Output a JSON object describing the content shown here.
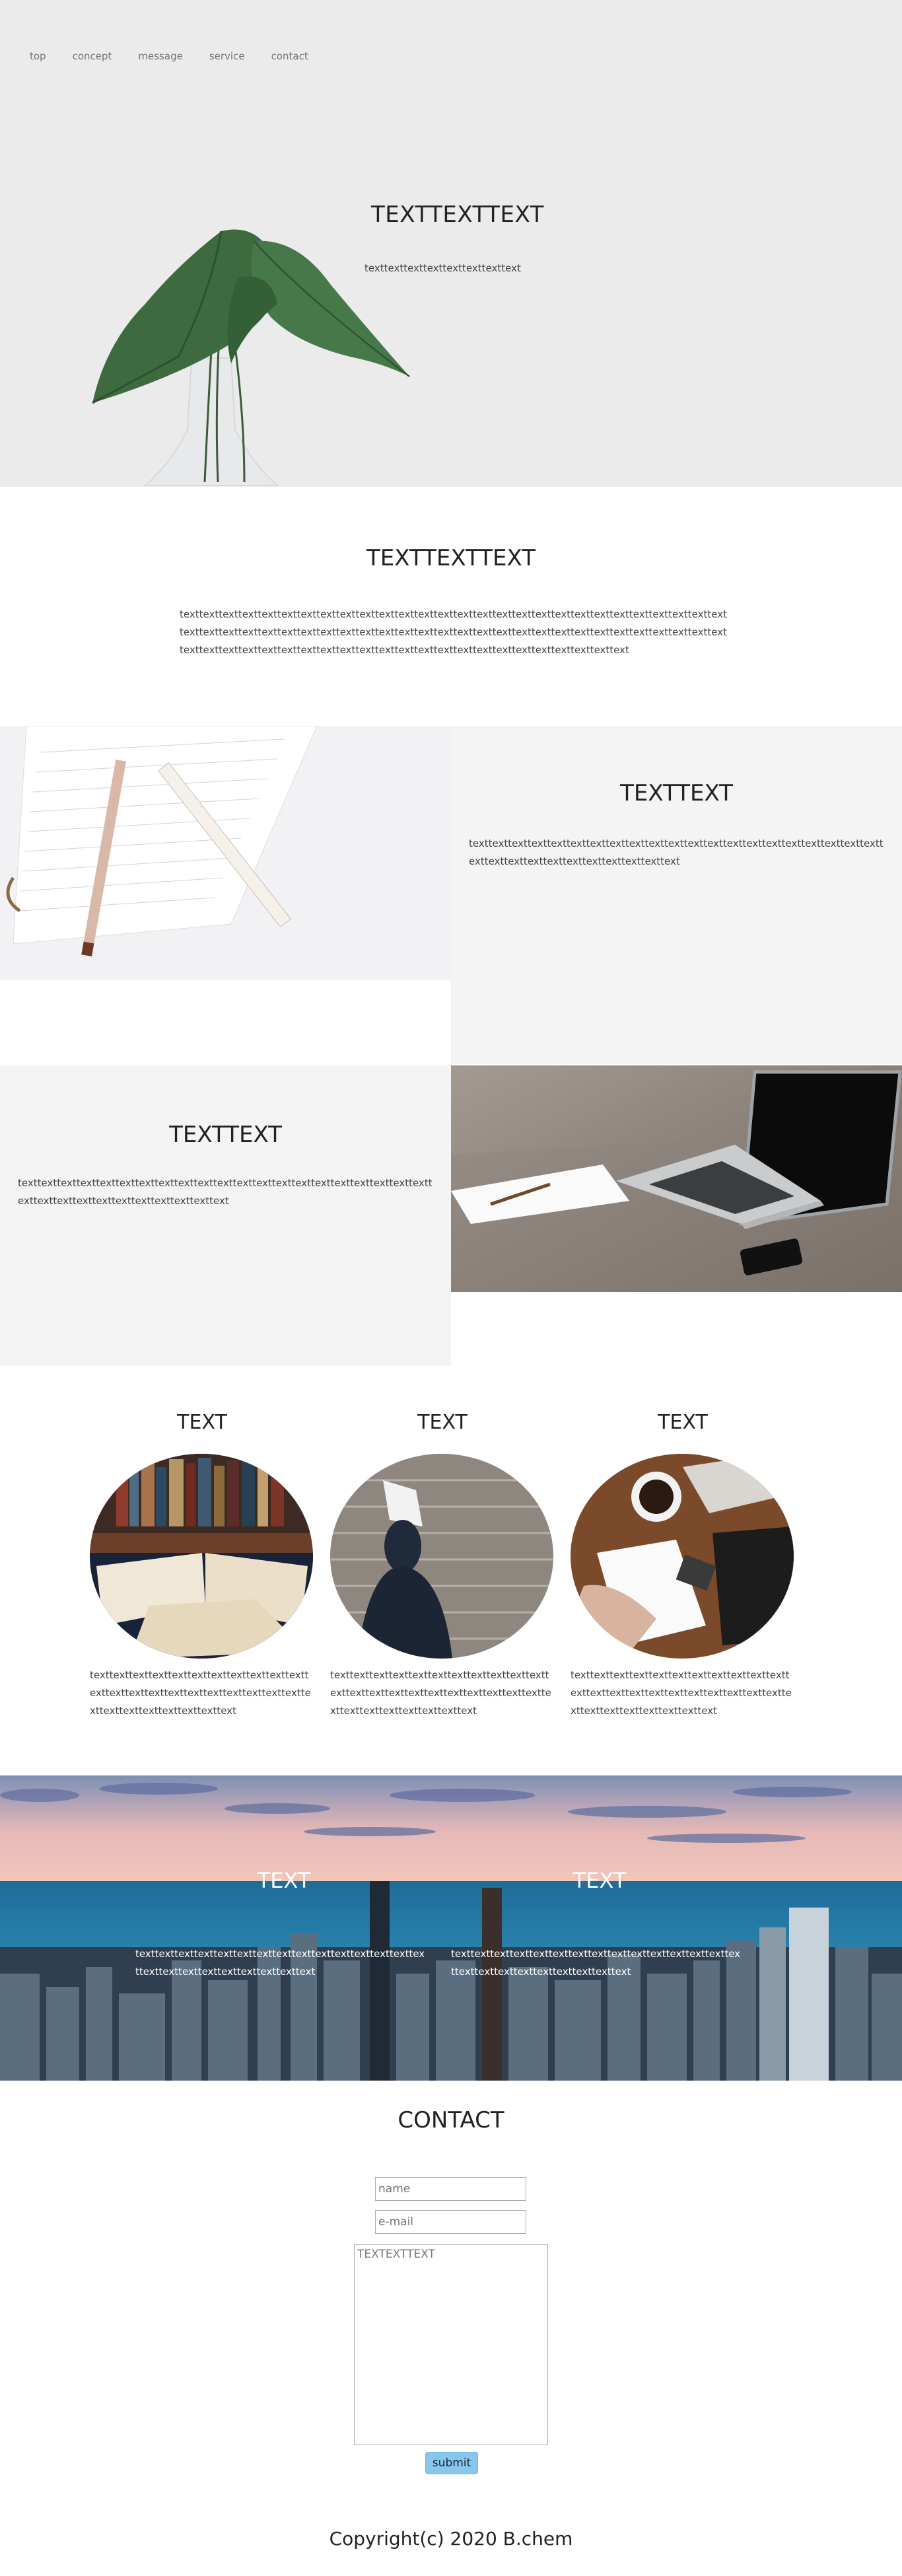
{
  "nav": {
    "items": [
      {
        "label": "top"
      },
      {
        "label": "concept"
      },
      {
        "label": "message"
      },
      {
        "label": "service"
      },
      {
        "label": "contact"
      }
    ]
  },
  "hero": {
    "title": "TEXTTEXTTEXT",
    "text": "texttexttexttexttexttexttexttext"
  },
  "intro": {
    "title": "TEXTTEXTTEXT",
    "text": "texttexttexttexttexttexttexttexttexttexttexttexttexttexttexttexttexttexttexttexttexttexttexttexttexttexttexttexttexttexttexttexttexttexttexttexttexttexttexttexttexttexttexttexttexttexttexttexttexttexttexttexttexttexttexttexttexttexttexttexttexttexttexttexttexttexttexttexttexttexttexttexttexttexttexttexttexttexttext"
  },
  "feature1": {
    "title": "TEXTTEXT",
    "text": "texttexttexttexttexttexttexttexttexttexttexttexttexttexttexttexttexttexttexttexttexttexttexttexttexttexttexttexttexttexttexttext"
  },
  "feature2": {
    "title": "TEXTTEXT",
    "text": "texttexttexttexttexttexttexttexttexttexttexttexttexttexttexttexttexttexttexttexttexttexttexttexttexttexttexttexttexttexttexttext"
  },
  "columns": [
    {
      "title": "TEXT",
      "text": "texttexttexttexttexttexttexttexttexttexttexttexttexttexttexttexttexttexttexttexttexttexttexttexttexttexttexttexttexttext"
    },
    {
      "title": "TEXT",
      "text": "texttexttexttexttexttexttexttexttexttexttexttexttexttexttexttexttexttexttexttexttexttexttexttexttexttexttexttexttexttext"
    },
    {
      "title": "TEXT",
      "text": "texttexttexttexttexttexttexttexttexttexttexttexttexttexttexttexttexttexttexttexttexttexttexttexttexttexttexttexttexttext"
    }
  ],
  "city": {
    "left": {
      "title": "TEXT",
      "text": "texttexttexttexttexttexttexttexttexttexttexttexttexttexttexttexttexttexttexttexttexttexttexttext"
    },
    "right": {
      "title": "TEXT",
      "text": "texttexttexttexttexttexttexttexttexttexttexttexttexttexttexttexttexttexttexttexttexttexttexttext"
    }
  },
  "contact": {
    "title": "CONTACT",
    "name_placeholder": "name",
    "email_placeholder": "e-mail",
    "message_placeholder": "TEXTEXTTEXT",
    "submit_label": "submit"
  },
  "footer": {
    "copyright": "Copyright(c) 2020 B.chem"
  }
}
